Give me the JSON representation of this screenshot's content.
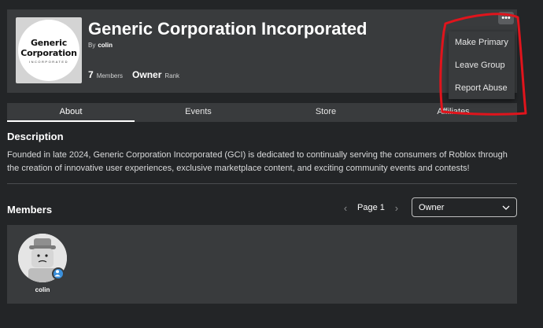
{
  "group": {
    "name": "Generic Corporation Incorporated",
    "owner_prefix": "By",
    "owner_name": "colin",
    "logo": {
      "line1": "Generic",
      "line2": "Corporation",
      "line3": "INCORPORATED"
    },
    "members_count": "7",
    "members_label": "Members",
    "rank_value": "Owner",
    "rank_label": "Rank"
  },
  "more_menu": {
    "button_glyph": "•••",
    "items": [
      "Make Primary",
      "Leave Group",
      "Report Abuse"
    ]
  },
  "tabs": [
    {
      "label": "About",
      "active": true
    },
    {
      "label": "Events",
      "active": false
    },
    {
      "label": "Store",
      "active": false
    },
    {
      "label": "Affiliates",
      "active": false
    }
  ],
  "about": {
    "title": "Description",
    "text": "Founded in late 2024, Generic Corporation Incorporated (GCI) is dedicated to continually serving the consumers of Roblox through the creation of innovative user experiences, exclusive marketplace content, and exciting community events and contests!"
  },
  "members": {
    "title": "Members",
    "pager_label": "Page 1",
    "role_filter": "Owner",
    "list": [
      {
        "name": "colin"
      }
    ]
  },
  "colors": {
    "background": "#232527",
    "panel": "#393b3d",
    "annotation": "#e0141c",
    "badge": "#3a8fdb"
  }
}
